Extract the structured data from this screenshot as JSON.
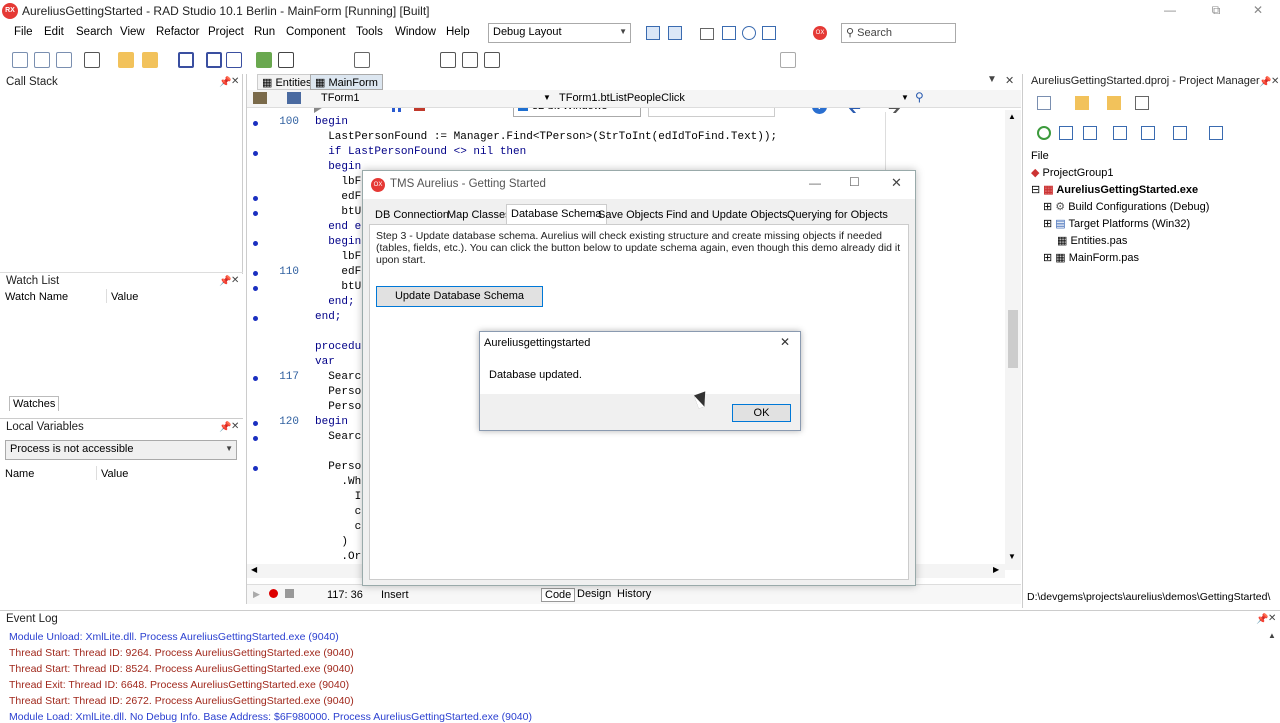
{
  "window": {
    "title": "AureliusGettingStarted - RAD Studio 10.1 Berlin - MainForm [Running] [Built]",
    "logo": "RX"
  },
  "menu": [
    "File",
    "Edit",
    "Search",
    "View",
    "Refactor",
    "Project",
    "Run",
    "Component",
    "Tools",
    "Window",
    "Help"
  ],
  "toolbar": {
    "layout": "Debug Layout",
    "platform": "32-bit Windows",
    "search_placeholder": "Search",
    "stop_badge": "OX"
  },
  "call_stack": {
    "title": "Call Stack"
  },
  "watch_list": {
    "title": "Watch List",
    "col_name": "Watch Name",
    "col_value": "Value",
    "tab": "Watches"
  },
  "local_vars": {
    "title": "Local Variables",
    "process": "Process is not accessible",
    "col_name": "Name",
    "col_value": "Value"
  },
  "editor": {
    "tabs": [
      "Entities",
      "MainForm"
    ],
    "class_combo": "TForm1",
    "method_combo": "TForm1.btListPeopleClick",
    "lines": [
      {
        "n": "100",
        "t": "begin"
      },
      {
        "n": "",
        "t": "  LastPersonFound := Manager.Find<TPerson>(StrToInt(edIdToFind.Text));"
      },
      {
        "n": "",
        "t": "  if LastPersonFound <> nil then"
      },
      {
        "n": "",
        "t": "  begin"
      },
      {
        "n": "",
        "t": "    lbF"
      },
      {
        "n": "",
        "t": "    edF"
      },
      {
        "n": "",
        "t": "    btU"
      },
      {
        "n": "",
        "t": "  end e"
      },
      {
        "n": "",
        "t": "  begin"
      },
      {
        "n": "",
        "t": "    lbF"
      },
      {
        "n": "110",
        "t": "    edF"
      },
      {
        "n": "",
        "t": "    btU"
      },
      {
        "n": "",
        "t": "  end;"
      },
      {
        "n": "",
        "t": "end;"
      },
      {
        "n": "",
        "t": ""
      },
      {
        "n": "",
        "t": "procedu"
      },
      {
        "n": "",
        "t": "var"
      },
      {
        "n": "117",
        "t": "  Searc"
      },
      {
        "n": "",
        "t": "  Perso"
      },
      {
        "n": "",
        "t": "  Perso"
      },
      {
        "n": "120",
        "t": "begin"
      },
      {
        "n": "",
        "t": "  Searc"
      },
      {
        "n": "",
        "t": ""
      },
      {
        "n": "",
        "t": "  Perso"
      },
      {
        "n": "",
        "t": "    .Wh"
      },
      {
        "n": "",
        "t": "      I"
      },
      {
        "n": "",
        "t": "      c"
      },
      {
        "n": "",
        "t": "      c"
      },
      {
        "n": "",
        "t": "    )"
      },
      {
        "n": "",
        "t": "    .Or"
      }
    ],
    "status_pos": "117: 36",
    "status_mode": "Insert",
    "bottom_tabs": [
      "Code",
      "Design",
      "History"
    ]
  },
  "app_window": {
    "title": "TMS Aurelius - Getting Started",
    "logo": "OX",
    "tabs": [
      "DB Connection",
      "Map Classes",
      "Database Schema",
      "Save Objects",
      "Find and Update Objects",
      "Querying for Objects"
    ],
    "active_tab": "Database Schema",
    "description": "Step 3 - Update database schema. Aurelius will check existing structure and create missing objects if needed (tables, fields, etc.). You can click the button below to update schema again, even though this demo already did it upon start.",
    "button": "Update Database Schema"
  },
  "msgbox": {
    "title": "Aureliusgettingstarted",
    "text": "Database updated.",
    "ok": "OK"
  },
  "project_manager": {
    "title": "AureliusGettingStarted.dproj - Project Manager",
    "file_label": "File",
    "tree": [
      "ProjectGroup1",
      "AureliusGettingStarted.exe",
      "Build Configurations (Debug)",
      "Target Platforms (Win32)",
      "Entities.pas",
      "MainForm.pas"
    ],
    "path": "D:\\devgems\\projects\\aurelius\\demos\\GettingStarted\\"
  },
  "event_log": {
    "title": "Event Log",
    "lines": [
      {
        "t": "Module Unload: XmlLite.dll. Process AureliusGettingStarted.exe (9040)",
        "c": "blue"
      },
      {
        "t": "Thread Start: Thread ID: 9264. Process AureliusGettingStarted.exe (9040)",
        "c": "red"
      },
      {
        "t": "Thread Start: Thread ID: 8524. Process AureliusGettingStarted.exe (9040)",
        "c": "red"
      },
      {
        "t": "Thread Exit: Thread ID: 6648. Process AureliusGettingStarted.exe (9040)",
        "c": "red"
      },
      {
        "t": "Thread Start: Thread ID: 2672. Process AureliusGettingStarted.exe (9040)",
        "c": "red"
      },
      {
        "t": "Module Load: XmlLite.dll. No Debug Info. Base Address: $6F980000. Process AureliusGettingStarted.exe (9040)",
        "c": "blue"
      }
    ]
  }
}
